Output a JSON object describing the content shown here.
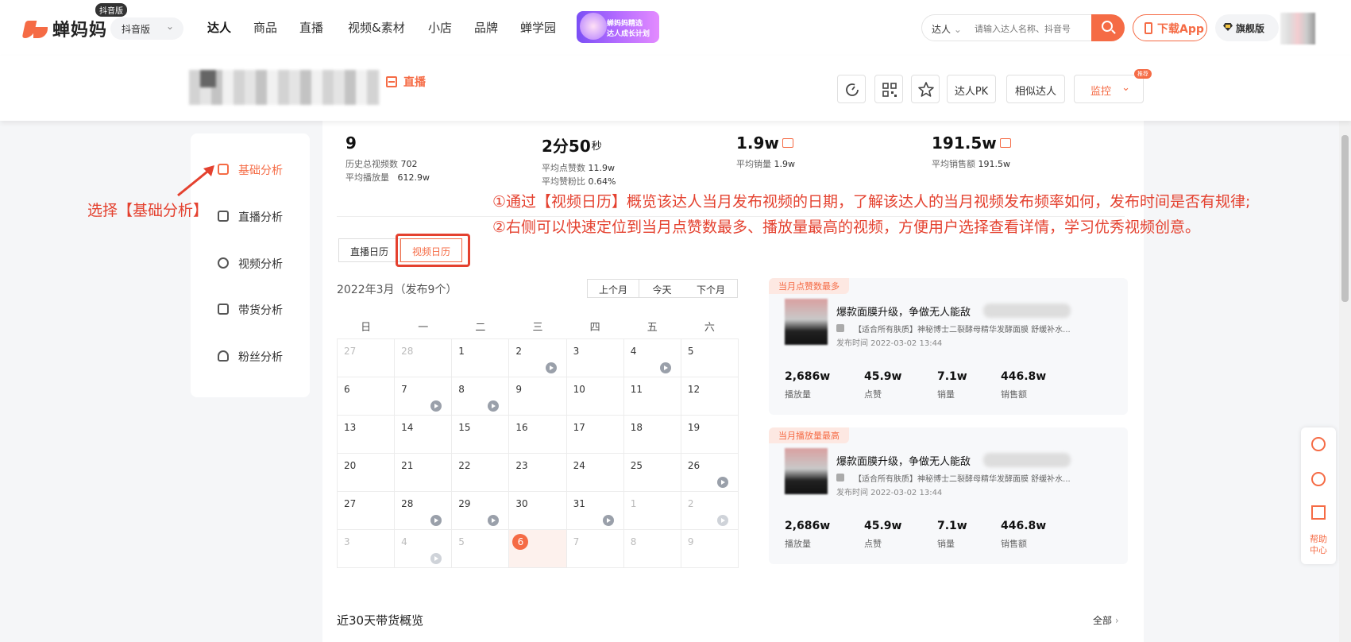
{
  "nav": {
    "logo": "蝉妈妈",
    "logo_badge": "抖音版",
    "platform": "抖音版",
    "items": [
      "达人",
      "商品",
      "直播",
      "视频&素材",
      "小店",
      "品牌",
      "蝉学园"
    ],
    "promo_lines": [
      "蝉妈妈精选",
      "达人成长计划"
    ],
    "search_type": "达人",
    "search_placeholder": "请输入达人名称、抖音号",
    "download": "下载App",
    "flagship": "旗舰版"
  },
  "profile": {
    "store_tag": "直播",
    "buttons": {
      "pk": "达人PK",
      "similar": "相似达人",
      "monitor": "监控",
      "recommend": "推荐"
    },
    "icons": [
      "refresh-icon",
      "qrcode-icon",
      "star-icon"
    ]
  },
  "sidebar": {
    "items": [
      {
        "label": "基础分析",
        "icon": "chart-icon"
      },
      {
        "label": "直播分析",
        "icon": "calendar-icon"
      },
      {
        "label": "视频分析",
        "icon": "play-icon"
      },
      {
        "label": "带货分析",
        "icon": "bag-icon"
      },
      {
        "label": "粉丝分析",
        "icon": "users-icon"
      }
    ]
  },
  "stats": [
    {
      "value": "9",
      "unit": "",
      "lines": [
        [
          "历史总视频数",
          "702"
        ],
        [
          "平均播放量",
          "612.9w"
        ]
      ]
    },
    {
      "value": "2分50",
      "unit": "秒",
      "lines": [
        [
          "平均点赞数",
          "11.9w"
        ],
        [
          "平均赞粉比",
          "0.64%"
        ]
      ]
    },
    {
      "value": "1.9w",
      "unit": "",
      "lines": [
        [
          "平均销量",
          "1.9w"
        ]
      ]
    },
    {
      "value": "191.5w",
      "unit": "",
      "lines": [
        [
          "平均销售额",
          "191.5w"
        ]
      ]
    }
  ],
  "tabs": {
    "live": "直播日历",
    "video": "视频日历"
  },
  "annotations": {
    "left": "选择【基础分析】",
    "right1": "①通过【视频日历】概览该达人当月发布视频的日期，了解该达人的当月视频发布频率如何，发布时间是否有规律;",
    "right2": "②右侧可以快速定位到当月点赞数最多、播放量最高的视频，方便用户选择查看详情，学习优秀视频创意。"
  },
  "calendar": {
    "title": "2022年3月（发布9个）",
    "nav": [
      "上个月",
      "今天",
      "下个月"
    ],
    "weekdays": [
      "日",
      "一",
      "二",
      "三",
      "四",
      "五",
      "六"
    ],
    "weeks": [
      [
        {
          "d": "27",
          "m": true
        },
        {
          "d": "28",
          "m": true
        },
        {
          "d": "1"
        },
        {
          "d": "2",
          "v": true
        },
        {
          "d": "3"
        },
        {
          "d": "4",
          "v": true
        },
        {
          "d": "5"
        }
      ],
      [
        {
          "d": "6"
        },
        {
          "d": "7",
          "v": true
        },
        {
          "d": "8",
          "v": true
        },
        {
          "d": "9"
        },
        {
          "d": "10"
        },
        {
          "d": "11"
        },
        {
          "d": "12"
        }
      ],
      [
        {
          "d": "13"
        },
        {
          "d": "14"
        },
        {
          "d": "15"
        },
        {
          "d": "16"
        },
        {
          "d": "17"
        },
        {
          "d": "18"
        },
        {
          "d": "19"
        }
      ],
      [
        {
          "d": "20"
        },
        {
          "d": "21"
        },
        {
          "d": "22"
        },
        {
          "d": "23"
        },
        {
          "d": "24"
        },
        {
          "d": "25"
        },
        {
          "d": "26",
          "v": true
        }
      ],
      [
        {
          "d": "27"
        },
        {
          "d": "28",
          "v": true
        },
        {
          "d": "29",
          "v": true
        },
        {
          "d": "30"
        },
        {
          "d": "31",
          "v": true
        },
        {
          "d": "1",
          "m": true
        },
        {
          "d": "2",
          "m": true,
          "v": true,
          "vl": true
        }
      ],
      [
        {
          "d": "3",
          "m": true
        },
        {
          "d": "4",
          "m": true,
          "v": true,
          "vl": true
        },
        {
          "d": "5",
          "m": true
        },
        {
          "d": "6",
          "today": true
        },
        {
          "d": "7",
          "m": true
        },
        {
          "d": "8",
          "m": true
        },
        {
          "d": "9",
          "m": true
        }
      ]
    ]
  },
  "cards": [
    {
      "tag": "当月点赞数最多",
      "title": "爆款面膜升级，争做无人能敌",
      "goods": "【适合所有肤质】神秘博士二裂酵母精华发酵面膜 舒缓补水...",
      "date": "发布时间 2022-03-02 13:44",
      "metrics": [
        [
          "2,686w",
          "播放量"
        ],
        [
          "45.9w",
          "点赞"
        ],
        [
          "7.1w",
          "销量"
        ],
        [
          "446.8w",
          "销售额"
        ]
      ]
    },
    {
      "tag": "当月播放量最高",
      "title": "爆款面膜升级，争做无人能敌",
      "goods": "【适合所有肤质】神秘博士二裂酵母精华发酵面膜 舒缓补水...",
      "date": "发布时间 2022-03-02 13:44",
      "metrics": [
        [
          "2,686w",
          "播放量"
        ],
        [
          "45.9w",
          "点赞"
        ],
        [
          "7.1w",
          "销量"
        ],
        [
          "446.8w",
          "销售额"
        ]
      ]
    }
  ],
  "section": {
    "title": "近30天带货概览",
    "all": "全部"
  },
  "float": {
    "help": "帮助\n中心"
  },
  "colors": {
    "accent": "#f56b45",
    "annotation": "#e4412f"
  }
}
